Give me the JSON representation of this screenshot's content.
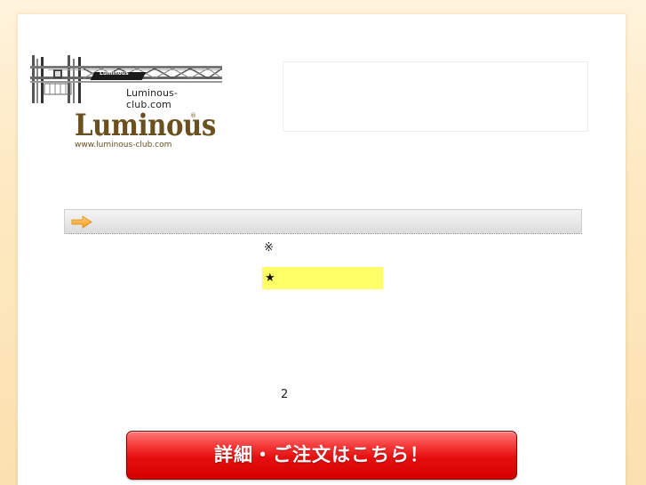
{
  "header": {
    "rack_logo_text": "Luminous-club.com",
    "rack_badge_text": "Luminous",
    "brand_name": "Luminous",
    "brand_reg": "®",
    "brand_url": "www.luminous-club.com"
  },
  "content": {
    "title_icon": "arrow-right-icon",
    "note_mark": "※",
    "highlight_text": "★",
    "page_number": "2"
  },
  "cta": {
    "order_label": "詳細・ご注文はこちら！"
  },
  "colors": {
    "background": "#fde9c2",
    "highlight": "#ffff66",
    "button": "#e50f0f",
    "brand": "#6a5020"
  }
}
